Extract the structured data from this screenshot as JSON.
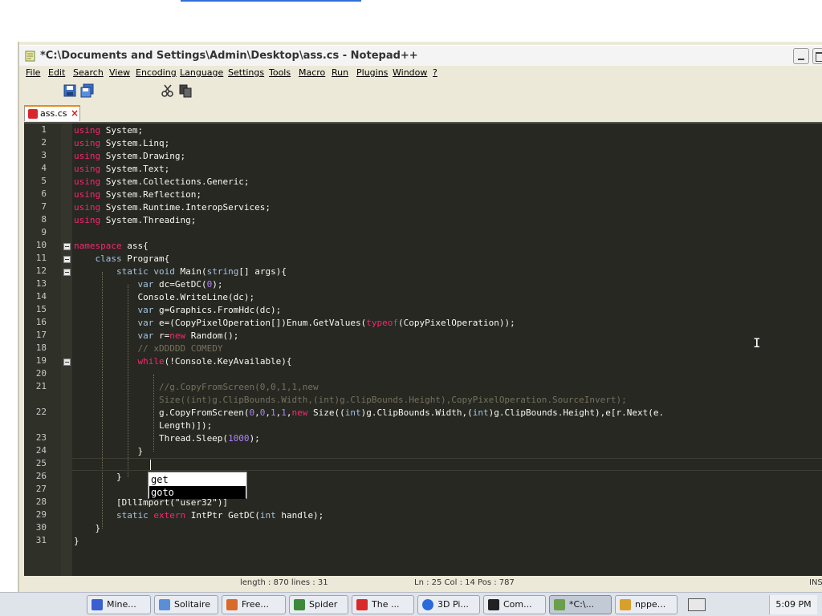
{
  "window": {
    "title": "*C:\\Documents and Settings\\Admin\\Desktop\\ass.cs - Notepad++"
  },
  "menu": {
    "items": [
      "File",
      "Edit",
      "Search",
      "View",
      "Encoding",
      "Language",
      "Settings",
      "Tools",
      "Macro",
      "Run",
      "Plugins",
      "Window",
      "?"
    ]
  },
  "tab": {
    "label": "ass.cs",
    "close": "×"
  },
  "editor": {
    "line_numbers": [
      "1",
      "2",
      "3",
      "4",
      "5",
      "6",
      "7",
      "8",
      "9",
      "10",
      "11",
      "12",
      "13",
      "14",
      "15",
      "16",
      "17",
      "18",
      "19",
      "20",
      "21",
      "",
      "22",
      "",
      "23",
      "24",
      "25",
      "26",
      "27",
      "28",
      "29",
      "30",
      "31"
    ],
    "autocomplete": [
      "get",
      "goto"
    ],
    "annotation_partial": "[DllImport(\"user32\")]"
  },
  "status": {
    "length": "length : 870    lines : 31",
    "position": "Ln : 25    Col : 14    Pos : 787",
    "mode": "INS"
  },
  "taskbar": {
    "buttons": [
      {
        "label": "Mine...",
        "color": "#3a5fd0"
      },
      {
        "label": "Solitaire",
        "color": "#5a8fd8"
      },
      {
        "label": "Free...",
        "color": "#d86a2a"
      },
      {
        "label": "Spider",
        "color": "#3a8a3a"
      },
      {
        "label": "The ...",
        "color": "#d82a2a"
      },
      {
        "label": "3D Pi...",
        "color": "#2a6ad8"
      },
      {
        "label": "Com...",
        "color": "#222222"
      },
      {
        "label": "*C:\\...",
        "color": "#6aa04a"
      },
      {
        "label": "nppe...",
        "color": "#d8a02a"
      }
    ],
    "clock": "5:09 PM"
  }
}
